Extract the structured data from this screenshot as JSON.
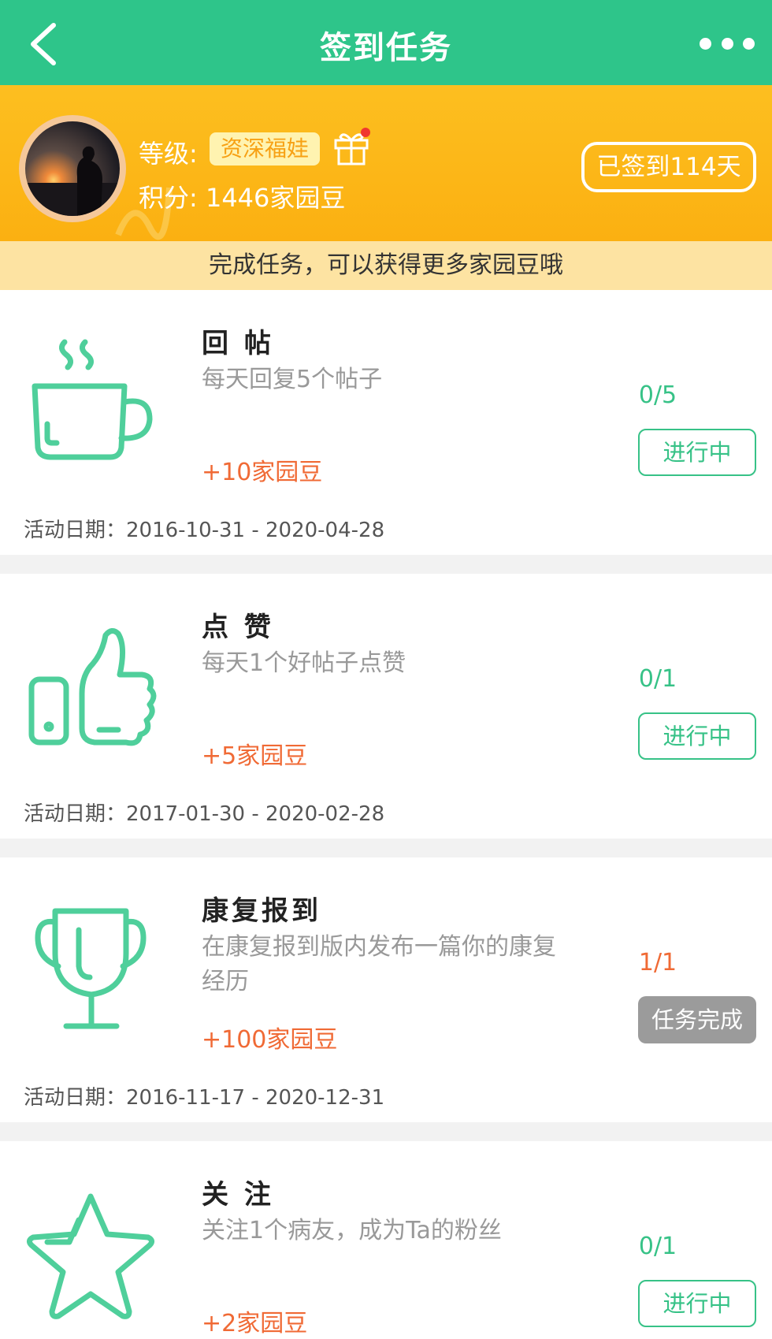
{
  "nav": {
    "title": "签到任务"
  },
  "profile": {
    "level_label": "等级:",
    "level_value": "资深福娃",
    "score_text": "积分: 1446家园豆",
    "signed_text": "已签到114天"
  },
  "tip": "完成任务，可以获得更多家园豆哦",
  "tasks": [
    {
      "name": "回 帖",
      "desc": "每天回复5个帖子",
      "reward": "+10家园豆",
      "progress": "0/5",
      "status": "进行中",
      "dates": "活动日期：2016-10-31 - 2020-04-28",
      "icon": "coffee-cup-icon"
    },
    {
      "name": "点 赞",
      "desc": "每天1个好帖子点赞",
      "reward": "+5家园豆",
      "progress": "0/1",
      "status": "进行中",
      "dates": "活动日期：2017-01-30 - 2020-02-28",
      "icon": "thumbs-up-icon"
    },
    {
      "name": "康复报到",
      "desc": "在康复报到版内发布一篇你的康复经历",
      "reward": "+100家园豆",
      "progress": "1/1",
      "status": "任务完成",
      "dates": "活动日期：2016-11-17 - 2020-12-31",
      "icon": "trophy-icon"
    },
    {
      "name": "关 注",
      "desc": "关注1个病友，成为Ta的粉丝",
      "reward": "+2家园豆",
      "progress": "0/1",
      "status": "进行中",
      "icon": "star-icon"
    }
  ],
  "colors": {
    "nav": "#2ec58a",
    "accent_green": "#37c287",
    "reward": "#f06a35",
    "progress_done": "#f06a35",
    "banner": "#fbb011"
  }
}
